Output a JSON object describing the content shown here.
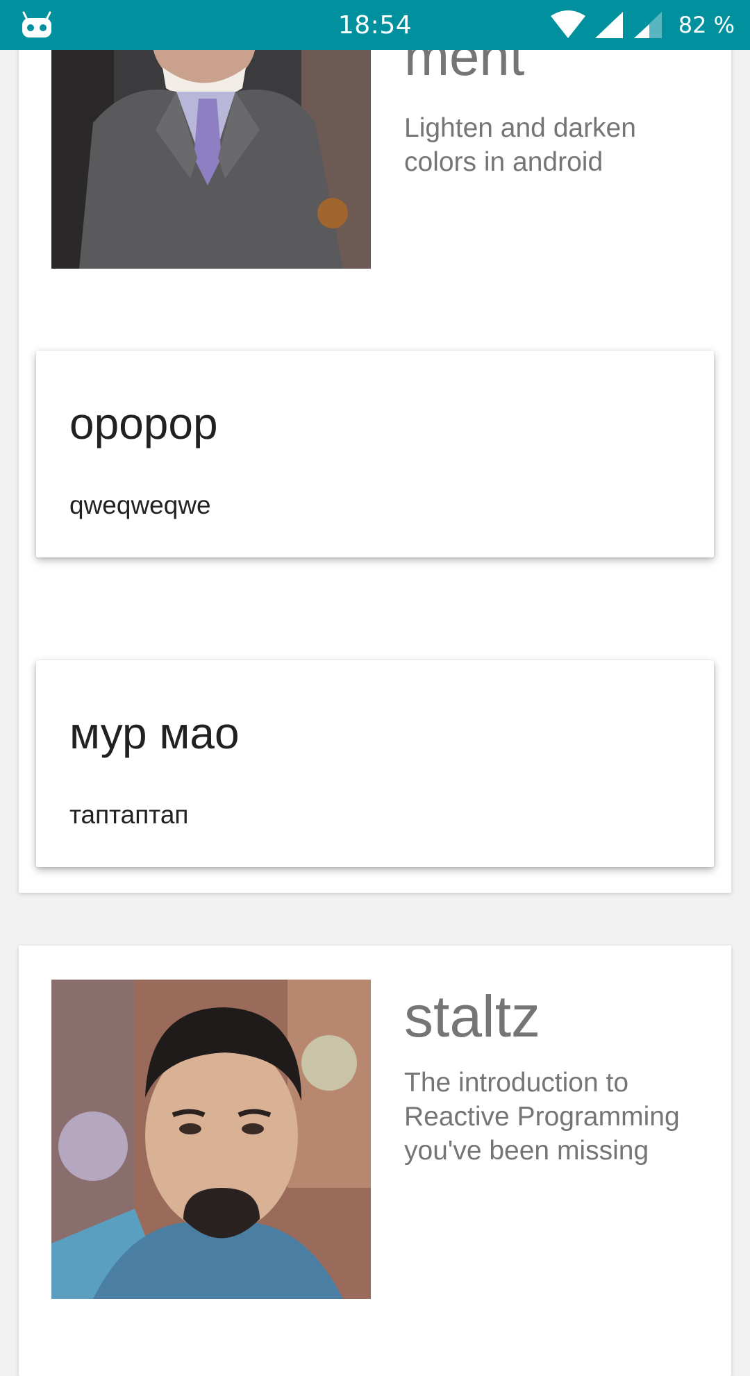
{
  "status_bar": {
    "time": "18:54",
    "battery": "82 %",
    "background": "#00909e",
    "icons": [
      "cyanogenmod-bugdroid-icon",
      "wifi-icon",
      "cell-signal-icon",
      "cell-signal-secondary-icon"
    ]
  },
  "feed": {
    "cards": [
      {
        "author_name": "ment",
        "article_title": "Lighten and darken colors in android",
        "avatar_icon": "author-avatar-photo",
        "comments": [
          {
            "title": "opopop",
            "body": "qweqweqwe"
          },
          {
            "title": "мур мао",
            "body": "таптаптап"
          }
        ]
      },
      {
        "author_name": "staltz",
        "article_title": "The introduction to Reactive Programming you've been missing",
        "avatar_icon": "author-avatar-photo"
      }
    ]
  },
  "colors": {
    "status_bar": "#00909e",
    "page_background": "#f1f1f1",
    "card": "#ffffff",
    "secondary_text": "#757575",
    "primary_text": "#212121"
  }
}
